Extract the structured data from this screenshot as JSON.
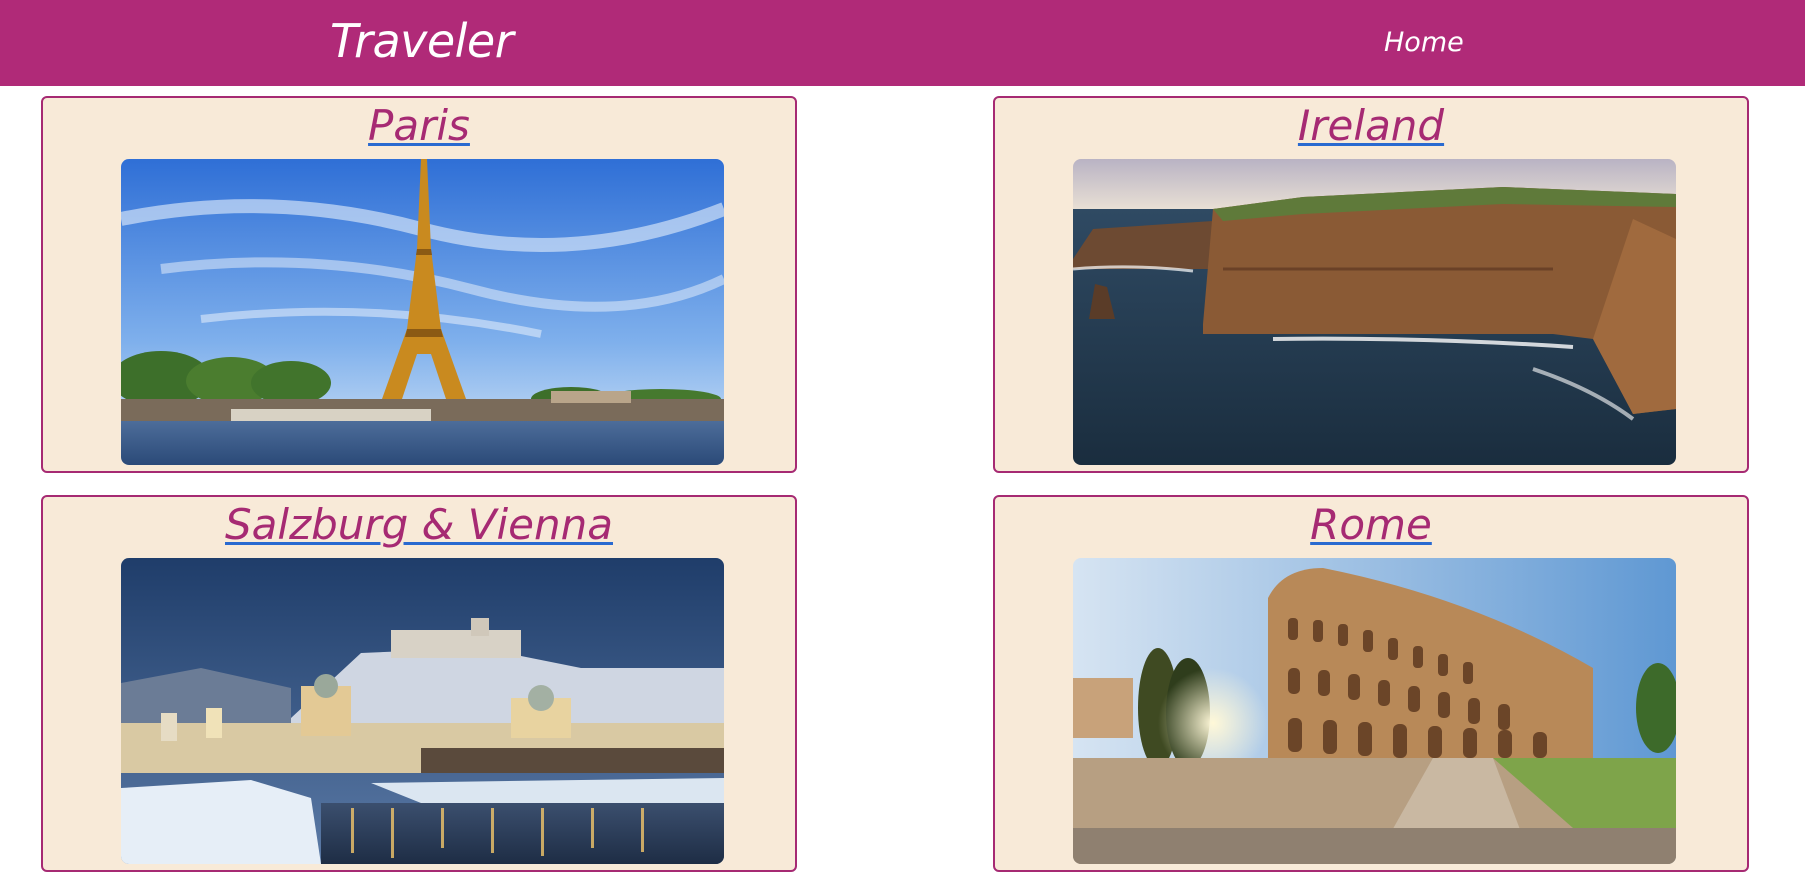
{
  "nav": {
    "brand": "Traveler",
    "home_label": "Home",
    "bg_color": "#b02a78"
  },
  "destinations": [
    {
      "title": "Paris",
      "image": "eiffel-tower-photo"
    },
    {
      "title": "Ireland",
      "image": "cliffs-of-moher-photo"
    },
    {
      "title": "Salzburg & Vienna",
      "image": "salzburg-winter-photo"
    },
    {
      "title": "Rome",
      "image": "colosseum-photo"
    }
  ],
  "colors": {
    "card_bg": "#f8ead8",
    "card_border": "#a62a73",
    "link_text": "#a62a73",
    "link_underline": "#2a6ad0"
  }
}
